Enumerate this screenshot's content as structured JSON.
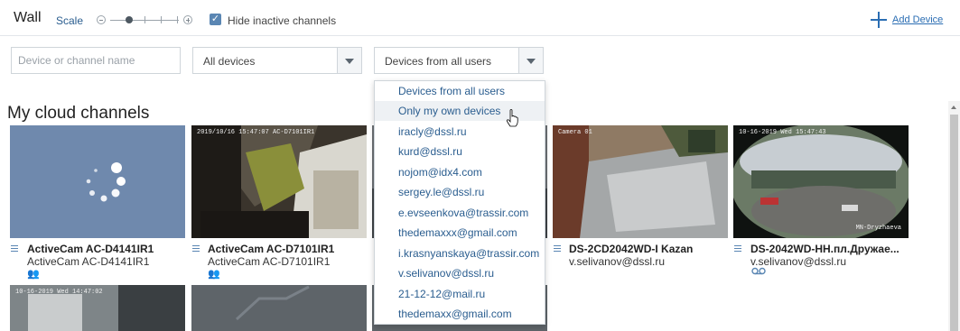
{
  "header": {
    "title": "Wall",
    "scale_label": "Scale",
    "hide_inactive_checked": true,
    "hide_inactive_label": "Hide inactive channels",
    "add_device_label": "Add Device"
  },
  "filters": {
    "search_placeholder": "Device or channel name",
    "device_select_value": "All devices",
    "user_select_value": "Devices from all users"
  },
  "section_title": "My cloud channels",
  "tiles_row1": [
    {
      "timestamp": "",
      "name": "ActiveCam AC-D4141IR1",
      "sub": "ActiveCam AC-D4141IR1",
      "badge": "shared-icon"
    },
    {
      "timestamp": "2019/10/16 15:47:07 AC-D7101IR1",
      "name": "ActiveCam AC-D7101IR1",
      "sub": "ActiveCam AC-D7101IR1",
      "badge": "shared-icon"
    },
    {
      "timestamp": "",
      "name": "",
      "sub": "",
      "badge": ""
    },
    {
      "timestamp": "Camera 01",
      "name": "DS-2CD2042WD-I Kazan",
      "sub": "v.selivanov@dssl.ru",
      "badge": ""
    },
    {
      "timestamp": "10-16-2019 Wed 15:47:43",
      "overlay_br": "MN-Dryzhaeva",
      "name": "DS-2042WD-HH.пл.Дружае...",
      "sub": "v.selivanov@dssl.ru",
      "badge": "record-icon"
    }
  ],
  "tiles_row2": [
    {
      "timestamp": "10-16-2019 Wed 14:47:02"
    },
    {
      "timestamp": ""
    },
    {
      "timestamp": ""
    }
  ],
  "user_dropdown": {
    "items": [
      "Devices from all users",
      "Only my own devices",
      "iracly@dssl.ru",
      "kurd@dssl.ru",
      "nojom@idx4.com",
      "sergey.le@dssl.ru",
      "e.evseenkova@trassir.com",
      "thedemaxxx@gmail.com",
      "i.krasnyanskaya@trassir.com",
      "v.selivanov@dssl.ru",
      "21-12-12@mail.ru",
      "thedemaxx@gmail.com"
    ],
    "hovered_index": 1
  },
  "colors": {
    "accent": "#2a6db3",
    "link": "#2a5d8f",
    "checkbox": "#5a86b3",
    "loading_tile": "#6f89ad"
  }
}
